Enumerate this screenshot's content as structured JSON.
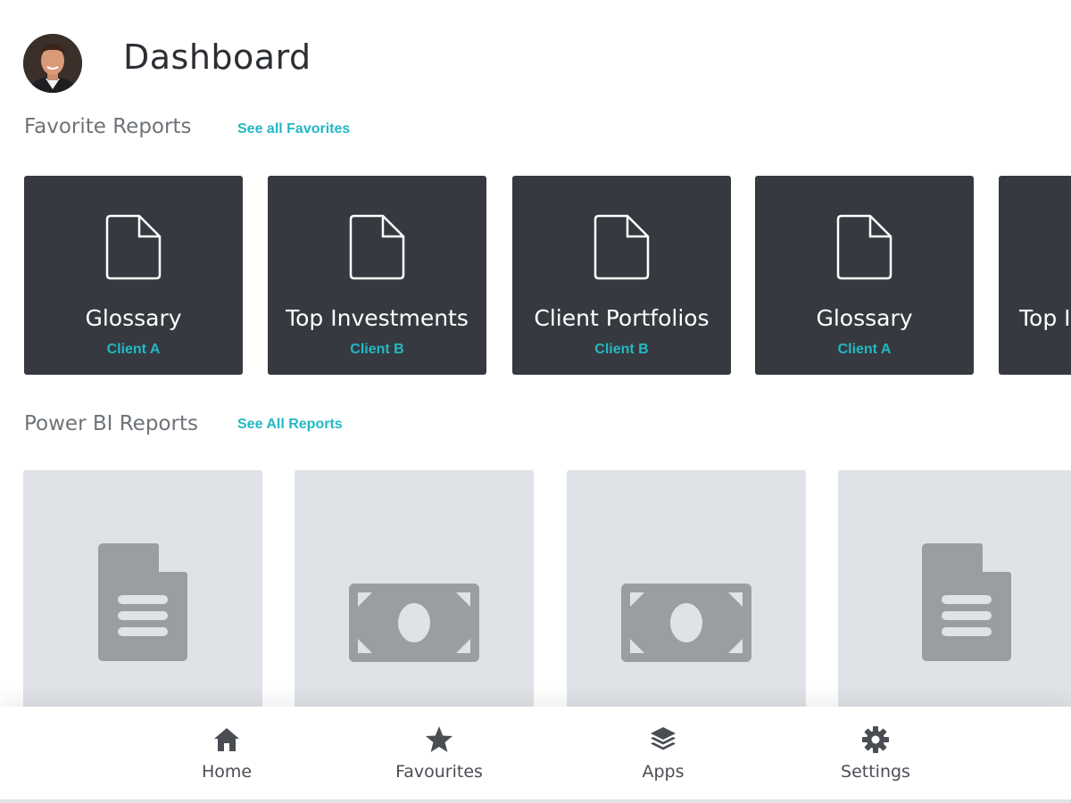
{
  "header": {
    "title": "Dashboard",
    "avatar_icon": "user-avatar"
  },
  "favorites": {
    "title": "Favorite Reports",
    "see_all": "See all Favorites",
    "items": [
      {
        "name": "Glossary",
        "client": "Client A",
        "icon": "document-outline-icon"
      },
      {
        "name": "Top Investments",
        "client": "Client B",
        "icon": "document-outline-icon"
      },
      {
        "name": "Client Portfolios",
        "client": "Client B",
        "icon": "document-outline-icon"
      },
      {
        "name": "Glossary",
        "client": "Client A",
        "icon": "document-outline-icon"
      },
      {
        "name": "Top I",
        "client": "",
        "icon": "document-outline-icon"
      }
    ]
  },
  "powerbi": {
    "title": "Power BI Reports",
    "see_all": "See All Reports",
    "items": [
      {
        "icon": "document-lines-icon"
      },
      {
        "icon": "money-bill-icon"
      },
      {
        "icon": "money-bill-icon"
      },
      {
        "icon": "document-lines-icon"
      }
    ]
  },
  "nav": {
    "items": [
      {
        "label": "Home",
        "icon": "home-icon"
      },
      {
        "label": "Favourites",
        "icon": "star-icon"
      },
      {
        "label": "Apps",
        "icon": "layers-icon"
      },
      {
        "label": "Settings",
        "icon": "gear-icon"
      }
    ]
  },
  "colors": {
    "accent": "#22b8c4",
    "tile_dark": "#363a40",
    "tile_light": "#dfe3e7",
    "icon_gray": "#9a9ea3"
  }
}
